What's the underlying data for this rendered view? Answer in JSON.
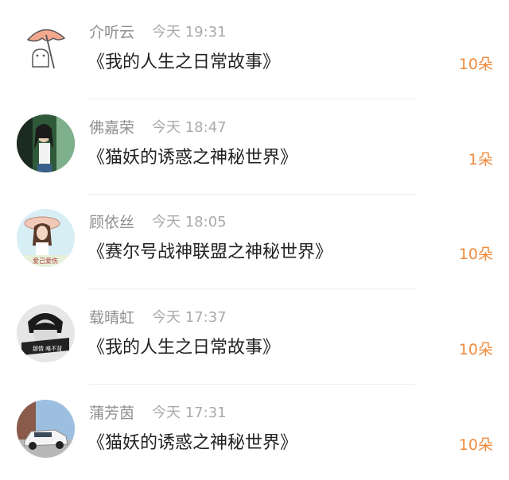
{
  "gifts": [
    {
      "name": "介听云",
      "time": "今天 19:31",
      "title": "《我的人生之日常故事》",
      "count": "10朵",
      "avatar_icon": "cartoon-umbrella-avatar-icon",
      "avatar_color": "#f2a58a"
    },
    {
      "name": "佛嘉荣",
      "time": "今天 18:47",
      "title": "《猫妖的诱惑之神秘世界》",
      "count": "1朵",
      "avatar_icon": "girl-photo-avatar-icon",
      "avatar_color": "#3f7a4f"
    },
    {
      "name": "顾依丝",
      "time": "今天 18:05",
      "title": "《赛尔号战神联盟之神秘世界》",
      "count": "10朵",
      "avatar_icon": "girl-with-hat-avatar-icon",
      "avatar_color": "#c9e6f2",
      "avatar_caption": "爱己爱伤"
    },
    {
      "name": "载晴虹",
      "time": "今天 17:37",
      "title": "《我的人生之日常故事》",
      "count": "10朵",
      "avatar_icon": "bw-portrait-avatar-icon",
      "avatar_color": "#2a2a2a",
      "avatar_caption": "那情 唯不背"
    },
    {
      "name": "蒲芳茵",
      "time": "今天 17:31",
      "title": "《猫妖的诱惑之神秘世界》",
      "count": "10朵",
      "avatar_icon": "white-car-avatar-icon",
      "avatar_color": "#8fb3d9"
    }
  ],
  "colors": {
    "count": "#f08a3c",
    "name": "#8f8f8f",
    "title": "#222222"
  }
}
